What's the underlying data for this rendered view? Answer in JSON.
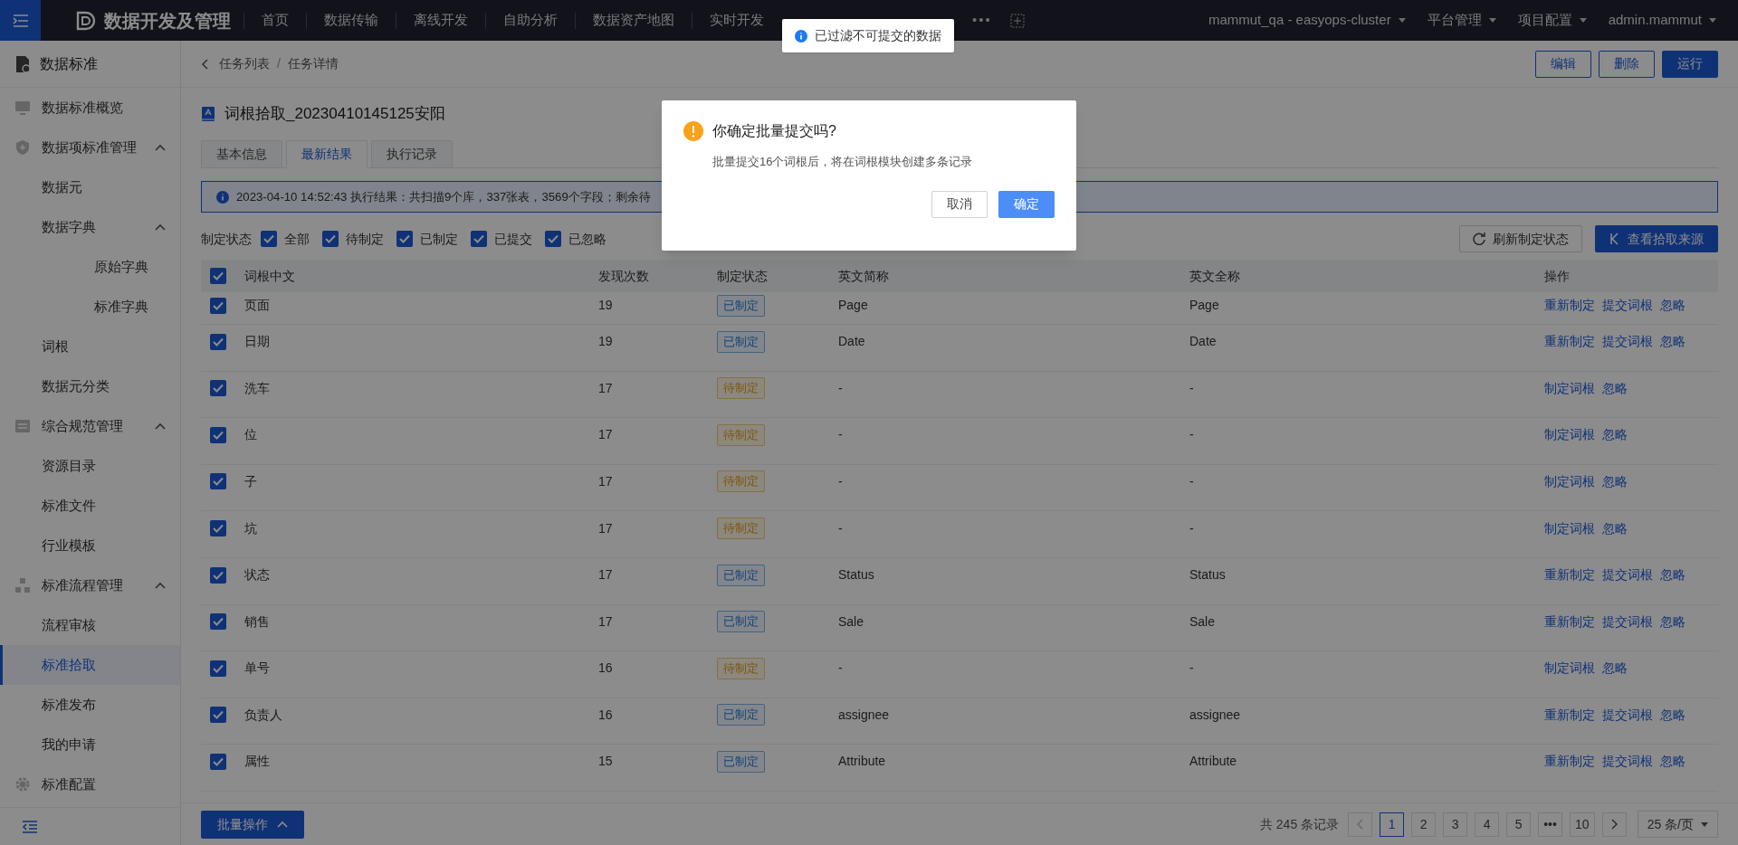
{
  "header": {
    "app_title": "数据开发及管理",
    "nav": [
      "首页",
      "数据传输",
      "离线开发",
      "自助分析",
      "数据资产地图",
      "实时开发"
    ],
    "more": "•••",
    "menus": [
      "mammut_qa - easyops-cluster",
      "平台管理",
      "项目配置",
      "admin.mammut"
    ]
  },
  "toast": {
    "text": "已过滤不可提交的数据"
  },
  "sidebar": {
    "title": "数据标准",
    "items": [
      {
        "label": "数据标准概览",
        "selected": false
      },
      {
        "label": "数据项标准管理",
        "expanded": true,
        "selected": false,
        "children": [
          {
            "label": "数据元",
            "selected": false
          },
          {
            "label": "数据字典",
            "expanded": true,
            "selected": false,
            "children": [
              {
                "label": "原始字典",
                "selected": false
              },
              {
                "label": "标准字典",
                "selected": false
              }
            ]
          },
          {
            "label": "词根",
            "selected": false
          },
          {
            "label": "数据元分类",
            "selected": false
          }
        ]
      },
      {
        "label": "综合规范管理",
        "expanded": true,
        "selected": false,
        "children": [
          {
            "label": "资源目录",
            "selected": false
          },
          {
            "label": "标准文件",
            "selected": false
          },
          {
            "label": "行业模板",
            "selected": false
          }
        ]
      },
      {
        "label": "标准流程管理",
        "expanded": true,
        "selected": false,
        "children": [
          {
            "label": "流程审核",
            "selected": false
          },
          {
            "label": "标准拾取",
            "selected": true
          },
          {
            "label": "标准发布",
            "selected": false
          },
          {
            "label": "我的申请",
            "selected": false
          }
        ]
      },
      {
        "label": "标准配置",
        "selected": false
      }
    ]
  },
  "breadcrumb": [
    "任务列表",
    "任务详情"
  ],
  "breadcrumb_separator": "/",
  "actions": [
    {
      "label": "编辑",
      "kind": "outline"
    },
    {
      "label": "删除",
      "kind": "outline"
    },
    {
      "label": "运行",
      "kind": "primary"
    }
  ],
  "task_title": "词根拾取_20230410145125安阳",
  "tabs": [
    {
      "label": "基本信息",
      "selected": false
    },
    {
      "label": "最新结果",
      "selected": true
    },
    {
      "label": "执行记录",
      "selected": false
    }
  ],
  "info": "2023-04-10 14:52:43 执行结果：共扫描9个库，337张表，3569个字段；剩余待",
  "filter": {
    "label": "制定状态",
    "options": [
      {
        "label": "全部",
        "checked": true
      },
      {
        "label": "待制定",
        "checked": true
      },
      {
        "label": "已制定",
        "checked": true
      },
      {
        "label": "已提交",
        "checked": true
      },
      {
        "label": "已忽略",
        "checked": true
      }
    ]
  },
  "toolbar": [
    "刷新制定状态",
    "查看拾取来源"
  ],
  "table": {
    "all_checked": true,
    "columns": [
      "词根中文",
      "发现次数",
      "制定状态",
      "英文简称",
      "英文全称",
      "操作"
    ],
    "rows": [
      {
        "checked": true,
        "name": "页面",
        "count": "19",
        "status": "已制定",
        "kind": "done",
        "abbr": "Page",
        "full": "Page",
        "ops": [
          "重新制定",
          "提交词根",
          "忽略"
        ]
      },
      {
        "checked": true,
        "name": "日期",
        "count": "19",
        "status": "已制定",
        "kind": "done",
        "abbr": "Date",
        "full": "Date",
        "ops": [
          "重新制定",
          "提交词根",
          "忽略"
        ]
      },
      {
        "checked": true,
        "name": "洗车",
        "count": "17",
        "status": "待制定",
        "kind": "pending",
        "abbr": "-",
        "full": "-",
        "ops": [
          "制定词根",
          "忽略"
        ]
      },
      {
        "checked": true,
        "name": "位",
        "count": "17",
        "status": "待制定",
        "kind": "pending",
        "abbr": "-",
        "full": "-",
        "ops": [
          "制定词根",
          "忽略"
        ]
      },
      {
        "checked": true,
        "name": "子",
        "count": "17",
        "status": "待制定",
        "kind": "pending",
        "abbr": "-",
        "full": "-",
        "ops": [
          "制定词根",
          "忽略"
        ]
      },
      {
        "checked": true,
        "name": "坑",
        "count": "17",
        "status": "待制定",
        "kind": "pending",
        "abbr": "-",
        "full": "-",
        "ops": [
          "制定词根",
          "忽略"
        ]
      },
      {
        "checked": true,
        "name": "状态",
        "count": "17",
        "status": "已制定",
        "kind": "done",
        "abbr": "Status",
        "full": "Status",
        "ops": [
          "重新制定",
          "提交词根",
          "忽略"
        ]
      },
      {
        "checked": true,
        "name": "销售",
        "count": "17",
        "status": "已制定",
        "kind": "done",
        "abbr": "Sale",
        "full": "Sale",
        "ops": [
          "重新制定",
          "提交词根",
          "忽略"
        ]
      },
      {
        "checked": true,
        "name": "单号",
        "count": "16",
        "status": "待制定",
        "kind": "pending",
        "abbr": "-",
        "full": "-",
        "ops": [
          "制定词根",
          "忽略"
        ]
      },
      {
        "checked": true,
        "name": "负责人",
        "count": "16",
        "status": "已制定",
        "kind": "done",
        "abbr": "assignee",
        "full": "assignee",
        "ops": [
          "重新制定",
          "提交词根",
          "忽略"
        ]
      },
      {
        "checked": true,
        "name": "属性",
        "count": "15",
        "status": "已制定",
        "kind": "done",
        "abbr": "Attribute",
        "full": "Attribute",
        "ops": [
          "重新制定",
          "提交词根",
          "忽略"
        ]
      }
    ]
  },
  "batch_button": "批量操作",
  "pagination": {
    "total": "共 245 条记录",
    "pages": [
      {
        "label": "1",
        "selected": true
      },
      {
        "label": "2",
        "selected": false
      },
      {
        "label": "3",
        "selected": false
      },
      {
        "label": "4",
        "selected": false
      },
      {
        "label": "5",
        "selected": false
      },
      {
        "label": "•••",
        "selected": false
      },
      {
        "label": "10",
        "selected": false
      }
    ],
    "page_size": "25 条/页"
  },
  "dialog": {
    "title": "你确定批量提交吗?",
    "message": "批量提交16个词根后，将在词根模块创建多条记录",
    "cancel": "取消",
    "confirm": "确定"
  }
}
